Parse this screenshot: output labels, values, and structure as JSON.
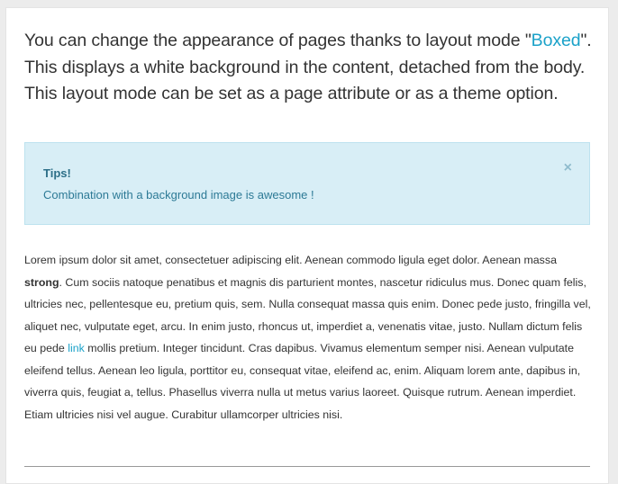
{
  "intro": {
    "before_link": "You can change the appearance of pages thanks to layout mode \"",
    "link_text": "Boxed",
    "after_link": "\". This displays a white background in the content, detached from the body. This layout mode can be set as a page attribute or as a theme option."
  },
  "alert": {
    "title": "Tips!",
    "message": "Combination with a background image is awesome !",
    "close_symbol": "×"
  },
  "lorem": {
    "part1": "Lorem ipsum dolor sit amet, consectetuer adipiscing elit. Aenean commodo ligula eget dolor. Aenean massa ",
    "strong": "strong",
    "part2": ". Cum sociis natoque penatibus et magnis dis parturient montes, nascetur ridiculus mus. Donec quam felis, ultricies nec, pellentesque eu, pretium quis, sem. Nulla consequat massa quis enim. Donec pede justo, fringilla vel, aliquet nec, vulputate eget, arcu. In enim justo, rhoncus ut, imperdiet a, venenatis vitae, justo. Nullam dictum felis eu pede ",
    "link_text": "link",
    "part3": " mollis pretium. Integer tincidunt. Cras dapibus. Vivamus elementum semper nisi. Aenean vulputate eleifend tellus. Aenean leo ligula, porttitor eu, consequat vitae, eleifend ac, enim. Aliquam lorem ante, dapibus in, viverra quis, feugiat a, tellus. Phasellus viverra nulla ut metus varius laoreet. Quisque rutrum. Aenean imperdiet. Etiam ultricies nisi vel augue. Curabitur ullamcorper ultricies nisi."
  },
  "colors": {
    "link": "#1ba2c9",
    "alert_background": "#d8eef6",
    "alert_text": "#2d7a96",
    "page_background": "#ececec",
    "card_background": "#ffffff"
  },
  "icons": {
    "alert_close": "close-icon"
  }
}
